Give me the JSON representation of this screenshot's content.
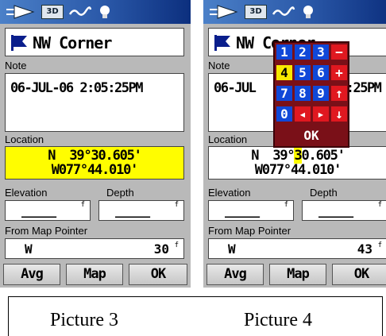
{
  "screens": [
    {
      "status_icons": [
        "arrow-icon",
        "3d-icon",
        "wave-icon",
        "bulb-icon"
      ],
      "status_3d": "3D",
      "title": "NW Corner",
      "note_label": "Note",
      "note": "06-JUL-06 2:05:25PM",
      "location_label": "Location",
      "lat": "N  39°30.605'",
      "lon": "W077°44.010'",
      "elevation_label": "Elevation",
      "depth_label": "Depth",
      "elevation_value": "_____",
      "depth_value": "_____",
      "unit_ft": "f",
      "from_pointer_label": "From Map Pointer",
      "pointer_direction": "W",
      "pointer_distance": "30",
      "pointer_unit": "f",
      "buttons": {
        "avg": "Avg",
        "map": "Map",
        "ok": "OK"
      }
    },
    {
      "status_3d": "3D",
      "title": "NW Corner",
      "note_label": "Note",
      "note_left": "06-JUL",
      "note_right": "5:25PM",
      "location_label": "Location",
      "lat_prefix": "N  39°",
      "lat_hl": "3",
      "lat_suffix": "0.605'",
      "lon": "W077°44.010'",
      "elevation_label": "Elevation",
      "depth_label": "Depth",
      "elevation_value": "_____",
      "depth_value": "_____",
      "unit_ft": "f",
      "from_pointer_label": "From Map Pointer",
      "pointer_direction": "W",
      "pointer_distance": "43",
      "pointer_unit": "f",
      "buttons": {
        "avg": "Avg",
        "map": "Map",
        "ok": "OK"
      },
      "keypad": {
        "rows": [
          [
            "1",
            "2",
            "3",
            "−"
          ],
          [
            "4",
            "5",
            "6",
            "+"
          ],
          [
            "7",
            "8",
            "9",
            "↑"
          ],
          [
            "0",
            "◂",
            "▸",
            "↓"
          ]
        ],
        "selected": "4",
        "ok": "OK"
      }
    }
  ],
  "captions": [
    "Picture 3",
    "Picture 4"
  ],
  "colors": {
    "highlight": "#fffd00",
    "status_bar": "#2a58a8",
    "keypad_bg": "#7a1018",
    "key_number": "#1048d8",
    "key_operator": "#e01820"
  }
}
